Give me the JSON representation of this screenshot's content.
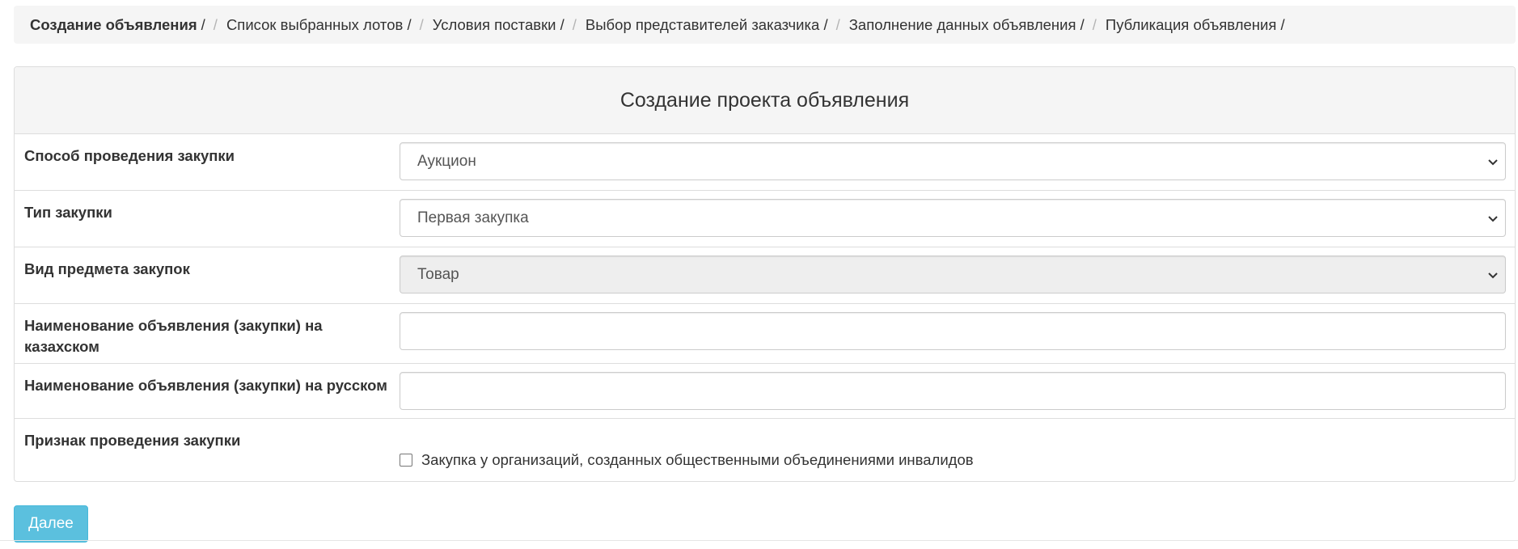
{
  "breadcrumb": {
    "items": [
      {
        "label": "Создание объявления",
        "trail": "/"
      },
      {
        "label": "Список выбранных лотов /"
      },
      {
        "label": "Условия поставки /"
      },
      {
        "label": "Выбор представителей заказчика /"
      },
      {
        "label": "Заполнение данных объявления /"
      },
      {
        "label": "Публикация объявления /"
      }
    ],
    "separator": "/"
  },
  "panel": {
    "title": "Создание проекта объявления"
  },
  "form": {
    "method": {
      "label": "Способ проведения закупки",
      "value": "Аукцион"
    },
    "purchase_type": {
      "label": "Тип закупки",
      "value": "Первая закупка"
    },
    "subject_kind": {
      "label": "Вид предмета закупок",
      "value": "Товар"
    },
    "name_kz": {
      "label": "Наименование объявления (закупки) на казахском",
      "value": ""
    },
    "name_ru": {
      "label": "Наименование объявления (закупки) на русском",
      "value": ""
    },
    "sign": {
      "label": "Признак проведения закупки",
      "checkbox_label": "Закупка у организаций, созданных общественными объединениями инвалидов"
    }
  },
  "actions": {
    "next_label": "Далее"
  },
  "colors": {
    "accent": "#5bc0de",
    "panel_bg": "#f5f5f5",
    "border": "#dddddd",
    "disabled_bg": "#eeeeee"
  },
  "icons": {
    "select_arrow": "chevron-down-icon"
  }
}
